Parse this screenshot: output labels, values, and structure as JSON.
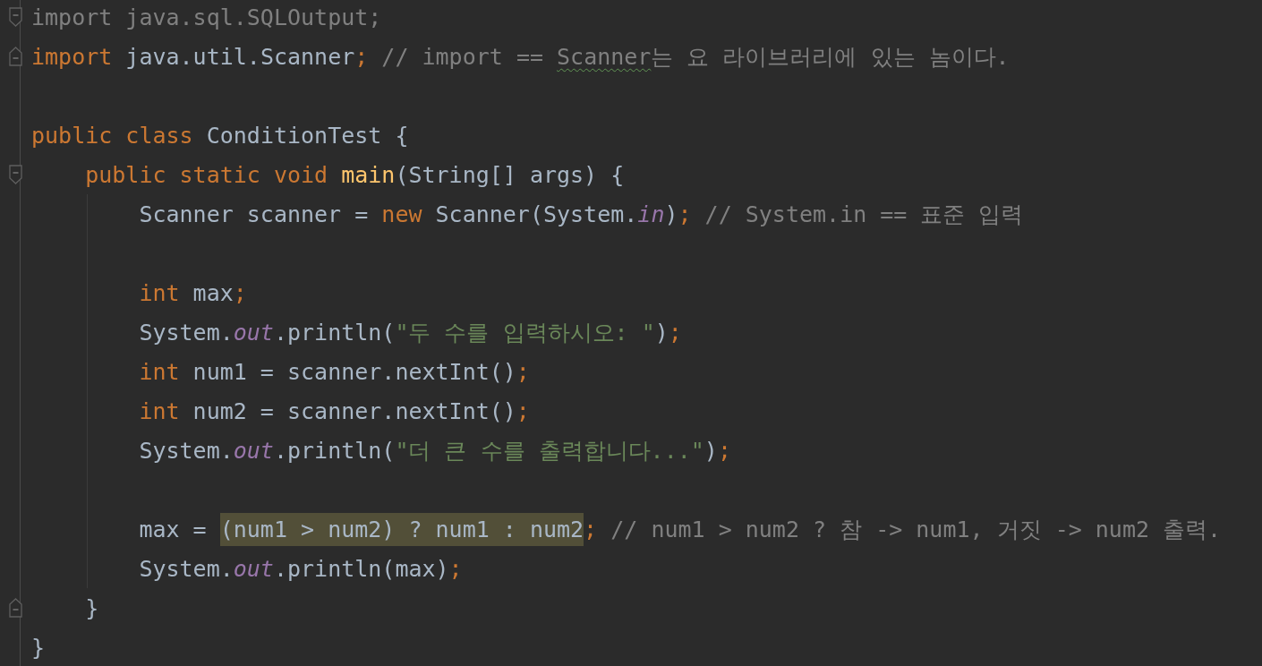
{
  "editor": {
    "lines": [
      {
        "kind": "fold_start",
        "tokens": [
          {
            "text": "import java.sql.SQLOutput;",
            "kind": "unused"
          }
        ]
      },
      {
        "kind": "fold_end",
        "tokens": [
          {
            "text": "import",
            "kind": "keyword"
          },
          {
            "text": " java.util.Scanner",
            "kind": "plain"
          },
          {
            "text": ";",
            "kind": "keyword"
          },
          {
            "text": " // import == ",
            "kind": "comment"
          },
          {
            "text": "Scanner",
            "kind": "comment",
            "typo": true
          },
          {
            "text": "는 요 라이브러리에 있는 놈이다.",
            "kind": "comment"
          }
        ]
      },
      {
        "kind": "blank"
      },
      {
        "kind": "code",
        "tokens": [
          {
            "text": "public class",
            "kind": "keyword"
          },
          {
            "text": " ConditionTest {",
            "kind": "plain"
          }
        ],
        "children": [
          {
            "kind": "fold_start",
            "tokens": [
              {
                "text": "public static void",
                "kind": "keyword"
              },
              {
                "text": " main",
                "kind": "method"
              },
              {
                "text": "(String[] args) {",
                "kind": "plain"
              }
            ],
            "children": [
              {
                "kind": "code",
                "tokens": [
                  {
                    "text": "Scanner scanner = ",
                    "kind": "plain"
                  },
                  {
                    "text": "new",
                    "kind": "keyword"
                  },
                  {
                    "text": " Scanner(System.",
                    "kind": "plain"
                  },
                  {
                    "text": "in",
                    "kind": "field"
                  },
                  {
                    "text": ")",
                    "kind": "plain"
                  },
                  {
                    "text": ";",
                    "kind": "keyword"
                  },
                  {
                    "text": " // System.in == 표준 입력",
                    "kind": "comment"
                  }
                ]
              },
              {
                "kind": "blank"
              },
              {
                "kind": "code",
                "tokens": [
                  {
                    "text": "int",
                    "kind": "keyword"
                  },
                  {
                    "text": " max",
                    "kind": "plain"
                  },
                  {
                    "text": ";",
                    "kind": "keyword"
                  }
                ]
              },
              {
                "kind": "code",
                "tokens": [
                  {
                    "text": "System.",
                    "kind": "plain"
                  },
                  {
                    "text": "out",
                    "kind": "field"
                  },
                  {
                    "text": ".println(",
                    "kind": "plain"
                  },
                  {
                    "text": "\"두 수를 입력하시오: \"",
                    "kind": "string"
                  },
                  {
                    "text": ")",
                    "kind": "plain"
                  },
                  {
                    "text": ";",
                    "kind": "keyword"
                  }
                ]
              },
              {
                "kind": "code",
                "tokens": [
                  {
                    "text": "int",
                    "kind": "keyword"
                  },
                  {
                    "text": " num1 = scanner.nextInt()",
                    "kind": "plain"
                  },
                  {
                    "text": ";",
                    "kind": "keyword"
                  }
                ]
              },
              {
                "kind": "code",
                "tokens": [
                  {
                    "text": "int",
                    "kind": "keyword"
                  },
                  {
                    "text": " num2 = scanner.nextInt()",
                    "kind": "plain"
                  },
                  {
                    "text": ";",
                    "kind": "keyword"
                  }
                ]
              },
              {
                "kind": "code",
                "tokens": [
                  {
                    "text": "System.",
                    "kind": "plain"
                  },
                  {
                    "text": "out",
                    "kind": "field"
                  },
                  {
                    "text": ".println(",
                    "kind": "plain"
                  },
                  {
                    "text": "\"더 큰 수를 출력합니다...\"",
                    "kind": "string"
                  },
                  {
                    "text": ")",
                    "kind": "plain"
                  },
                  {
                    "text": ";",
                    "kind": "keyword"
                  }
                ]
              },
              {
                "kind": "blank"
              },
              {
                "kind": "code",
                "tokens": [
                  {
                    "text": "max = ",
                    "kind": "plain"
                  },
                  {
                    "text": "(num1 > num2) ? num1 : num2",
                    "kind": "plain",
                    "highlighted": true
                  },
                  {
                    "text": ";",
                    "kind": "keyword"
                  },
                  {
                    "text": " // num1 > num2 ? 참 -> num1, 거짓 -> num2 출력.",
                    "kind": "comment"
                  }
                ]
              },
              {
                "kind": "code",
                "tokens": [
                  {
                    "text": "System.",
                    "kind": "plain"
                  },
                  {
                    "text": "out",
                    "kind": "field"
                  },
                  {
                    "text": ".println(max)",
                    "kind": "plain"
                  },
                  {
                    "text": ";",
                    "kind": "keyword"
                  }
                ]
              }
            ]
          },
          {
            "kind": "fold_end",
            "tokens": [
              {
                "text": "}",
                "kind": "plain"
              }
            ]
          }
        ]
      },
      {
        "kind": "code",
        "tokens": [
          {
            "text": "}",
            "kind": "plain"
          }
        ]
      }
    ]
  }
}
